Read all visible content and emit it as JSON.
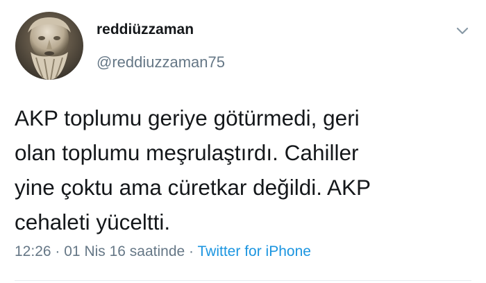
{
  "tweet": {
    "display_name": "reddiüzzaman",
    "handle": "@reddiuzzaman75",
    "text": "AKP toplumu geriye götürmedi, geri\nolan toplumu meşrulaştırdı. Cahiller\nyine çoktu ama cüretkar değildi. AKP\ncehaleti yüceltti.",
    "time": "12:26",
    "date": "01 Nis 16 saatinde",
    "separator": "·",
    "source": "Twitter for iPhone"
  },
  "icons": {
    "avatar": "sculpture-portrait-avatar",
    "menu": "chevron-down-icon"
  },
  "colors": {
    "text": "#14171a",
    "secondary": "#657786",
    "link": "#1b95e0",
    "divider": "#e6ecf0"
  }
}
